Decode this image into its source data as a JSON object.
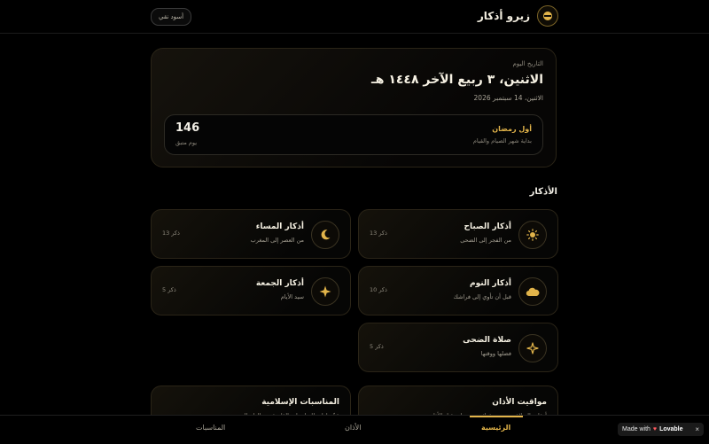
{
  "header": {
    "app_title": "زيرو أذكار",
    "theme_toggle_label": "أسود نقي"
  },
  "today": {
    "label": "التاريخ اليوم",
    "hijri": "الاثنين، ٣ ربيع الآخر ١٤٤٨ هـ",
    "gregorian": "الاثنين، 14 سبتمبر 2026"
  },
  "countdown": {
    "title": "أول رمضان",
    "subtitle": "بداية شهر الصيام والقيام",
    "value": "146",
    "unit": "يوم متبق"
  },
  "azkar_section": {
    "title": "الأذكار",
    "items": [
      {
        "title": "أذكار الصباح",
        "subtitle": "من الفجر إلى الضحى",
        "count": "13 ذكر",
        "icon": "sun-icon"
      },
      {
        "title": "أذكار المساء",
        "subtitle": "من العصر إلى المغرب",
        "count": "13 ذكر",
        "icon": "moon-icon"
      },
      {
        "title": "أذكار النوم",
        "subtitle": "قبل أن تأوي إلى فراشك",
        "count": "10 ذكر",
        "icon": "cloud-icon"
      },
      {
        "title": "أذكار الجمعة",
        "subtitle": "سيد الأيام",
        "count": "5 ذكر",
        "icon": "star-icon"
      },
      {
        "title": "صلاة الضحى",
        "subtitle": "فضلها ووقتها",
        "count": "5 ذكر",
        "icon": "sparkle-icon"
      }
    ]
  },
  "more_sections": [
    {
      "title": "مواقيت الأذان",
      "subtitle": "أوقات الصلاة حسب موقعك مع تنبيهات قبل الأذان"
    },
    {
      "title": "المناسبات الإسلامية",
      "subtitle": "عدّ تنازلي للمناسبات القادمة من العام الهجري"
    }
  ],
  "bottom_nav": {
    "items": [
      "الرئيسية",
      "الأذان",
      "المناسبات"
    ]
  },
  "badge": {
    "prefix": "Made with",
    "brand": "Lovable",
    "close": "×"
  },
  "colors": {
    "background": "#000000",
    "accent": "#e2b44a",
    "card_border": "#2a2417",
    "text": "#f2efe6"
  }
}
